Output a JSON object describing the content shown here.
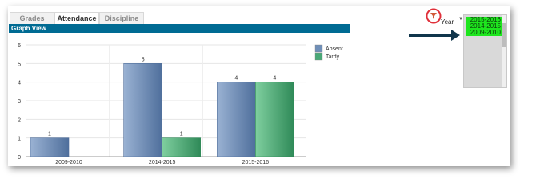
{
  "tabs": [
    {
      "label": "Grades"
    },
    {
      "label": "Attendance"
    },
    {
      "label": "Discipline"
    }
  ],
  "graph_title": "Graph View",
  "filter": {
    "label": "Year",
    "items": [
      "2015-2016",
      "2014-2015",
      "2009-2010"
    ],
    "icon": "filter-icon"
  },
  "colors": {
    "header": "#006b93",
    "absent": "#6f8fb8",
    "tardy": "#49a877",
    "selected": "#1ee61e",
    "arrow": "#10354b"
  },
  "chart_data": {
    "type": "bar",
    "categories": [
      "2009-2010",
      "2014-2015",
      "2015-2016"
    ],
    "series": [
      {
        "name": "Absent",
        "values": [
          1,
          5,
          4
        ]
      },
      {
        "name": "Tardy",
        "values": [
          null,
          1,
          4
        ]
      }
    ],
    "ylim": [
      0,
      6
    ],
    "yticks": [
      "0",
      "1",
      "2",
      "3",
      "4",
      "5",
      "6"
    ],
    "data_labels": {
      "Absent": [
        "1",
        "5",
        "4"
      ],
      "Tardy": [
        "",
        "1",
        "4"
      ]
    },
    "grid": true,
    "legend": "top-right"
  }
}
